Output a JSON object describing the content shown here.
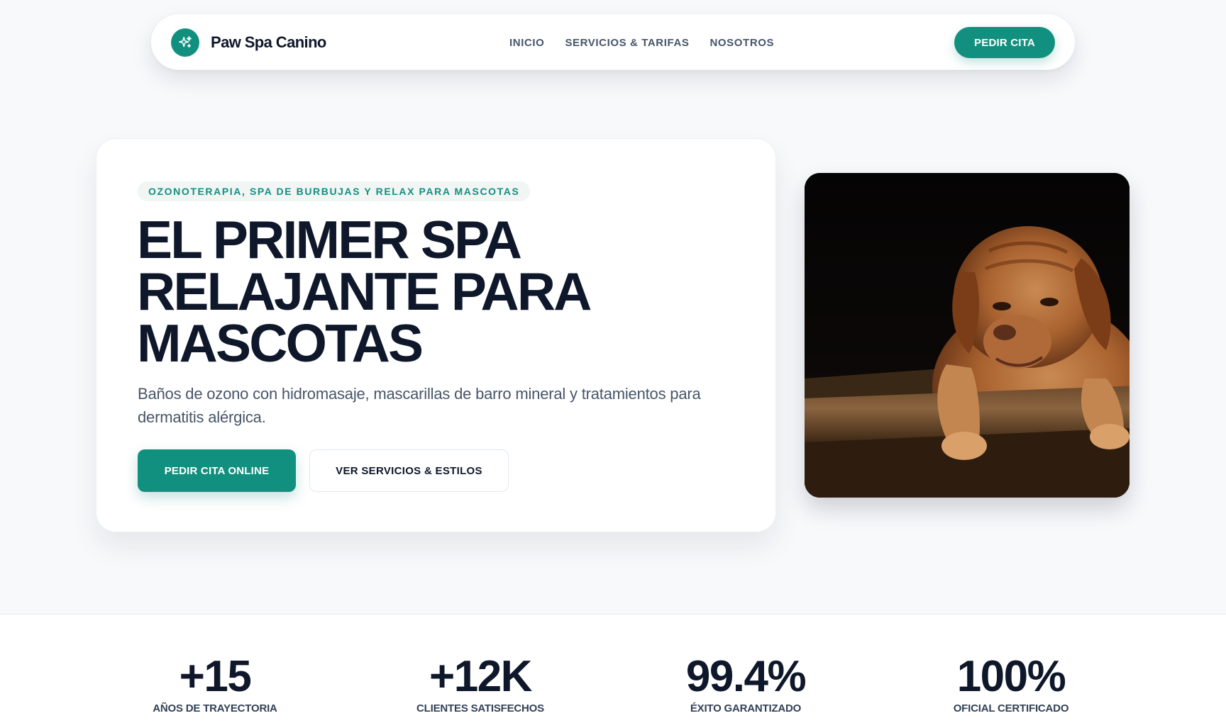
{
  "brand": {
    "name": "Paw Spa Canino",
    "icon": "sparkles-icon",
    "accent": "#12907f"
  },
  "nav": {
    "links": [
      "INICIO",
      "SERVICIOS & TARIFAS",
      "NOSOTROS"
    ],
    "cta": "PEDIR CITA"
  },
  "hero": {
    "eyebrow": "OZONOTERAPIA, SPA DE BURBUJAS Y RELAX PARA MASCOTAS",
    "title_lines": [
      "EL PRIMER SPA",
      "RELAJANTE PARA",
      "MASCOTAS"
    ],
    "description": "Baños de ozono con hidromasaje, mascarillas de barro mineral y tratamientos para dermatitis alérgica.",
    "primary_button": "PEDIR CITA ONLINE",
    "secondary_button": "VER SERVICIOS & ESTILOS",
    "image": "puppy-photo"
  },
  "stats": [
    {
      "value": "+15",
      "label": "AÑOS DE TRAYECTORIA"
    },
    {
      "value": "+12K",
      "label": "CLIENTES SATISFECHOS"
    },
    {
      "value": "99.4%",
      "label": "ÉXITO GARANTIZADO"
    },
    {
      "value": "100%",
      "label": "OFICIAL CERTIFICADO"
    }
  ]
}
